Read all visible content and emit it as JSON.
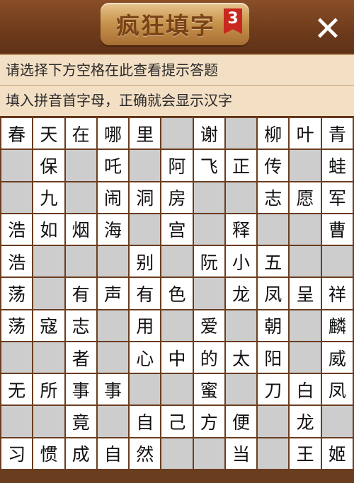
{
  "header": {
    "title": "疯狂填字",
    "level_badge": "3",
    "close_glyph": "✕"
  },
  "hints": [
    "请选择下方空格在此查看提示答题",
    "填入拼音首字母，正确就会显示汉字"
  ],
  "grid": [
    [
      "春",
      "天",
      "在",
      "哪",
      "里",
      "",
      "谢",
      "",
      "柳",
      "叶",
      "青"
    ],
    [
      "",
      "保",
      "",
      "吒",
      "",
      "阿",
      "飞",
      "正",
      "传",
      "",
      "蛙"
    ],
    [
      "",
      "九",
      "",
      "闹",
      "洞",
      "房",
      "",
      "",
      "志",
      "愿",
      "军"
    ],
    [
      "浩",
      "如",
      "烟",
      "海",
      "",
      "宫",
      "",
      "释",
      "",
      "",
      "曹"
    ],
    [
      "浩",
      "",
      "",
      "",
      "别",
      "",
      "阮",
      "小",
      "五",
      "",
      ""
    ],
    [
      "荡",
      "",
      "有",
      "声",
      "有",
      "色",
      "",
      "龙",
      "凤",
      "呈",
      "祥"
    ],
    [
      "荡",
      "寇",
      "志",
      "",
      "用",
      "",
      "爱",
      "",
      "朝",
      "",
      "麟"
    ],
    [
      "",
      "",
      "者",
      "",
      "心",
      "中",
      "的",
      "太",
      "阳",
      "",
      "威"
    ],
    [
      "无",
      "所",
      "事",
      "事",
      "",
      "",
      "蜜",
      "",
      "刀",
      "白",
      "凤"
    ],
    [
      "",
      "",
      "竟",
      "",
      "自",
      "己",
      "方",
      "便",
      "",
      "龙",
      ""
    ],
    [
      "习",
      "惯",
      "成",
      "自",
      "然",
      "",
      "",
      "当",
      "",
      "王",
      "姬"
    ]
  ]
}
